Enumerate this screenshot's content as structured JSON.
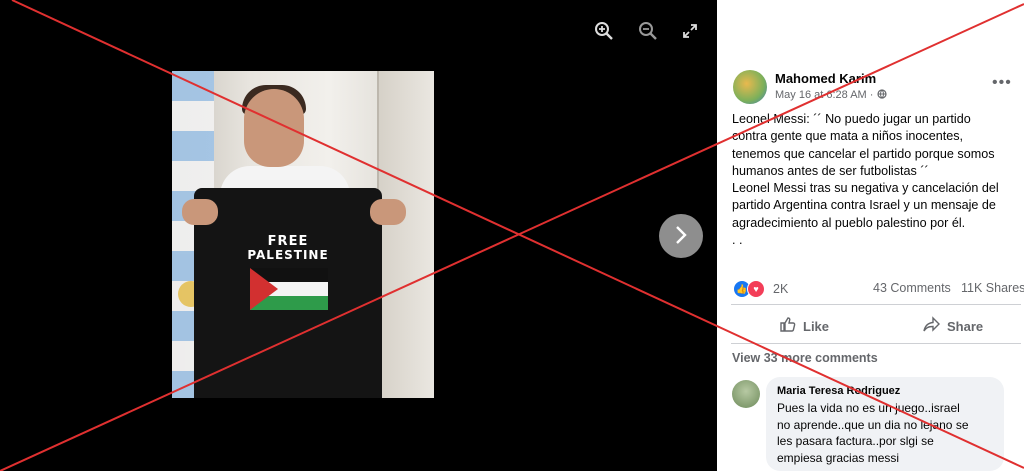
{
  "viewer": {
    "icons": [
      "zoom-in-icon",
      "zoom-out-icon",
      "fullscreen-icon",
      "chevron-right-icon"
    ],
    "image_text": {
      "line1": "FREE",
      "line2": "PALESTINE"
    }
  },
  "post": {
    "author": "Mahomed Karim",
    "date": "May 16 at 6:28 AM",
    "visibility_icon": "globe-icon",
    "text": "Leonel Messi: ´´ No puedo jugar un partido\ncontra gente que mata a niños inocentes,\ntenemos que cancelar el partido porque somos\nhumanos antes de ser futbolistas ´´\nLeonel Messi tras su negativa y cancelación del\npartido Argentina contra Israel y un mensaje de\nagradecimiento al pueblo palestino por él.\n. .",
    "reactions_count": "2K",
    "comments_count": "43 Comments",
    "shares_count": "11K Shares",
    "actions": {
      "like": "Like",
      "share": "Share"
    }
  },
  "comments": {
    "view_more": "View 33 more comments",
    "items": [
      {
        "author": "Maria Teresa Rodriguez",
        "text": "Pues la vida no es un juego..israel\nno aprende..que un dia no lejano se\nles pasara factura..por slgi se\nempiesa gracias messi"
      }
    ]
  },
  "colors": {
    "viewer_bg": "#000000",
    "overlay_x": "#e03030",
    "like_blue": "#1877f2",
    "love_red": "#f33e58",
    "muted_text": "#65676b"
  }
}
